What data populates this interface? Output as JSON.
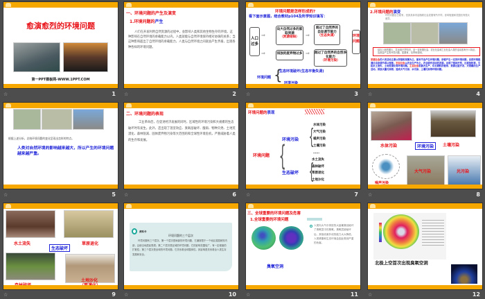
{
  "slides": [
    {
      "number": "1",
      "title": "愈演愈烈的环境问题",
      "footer": "第一PPT模板网-WWW.1PPT.COM"
    },
    {
      "number": "2",
      "heading": "一、环境问题的产生及演变",
      "sub_prefix": "1.环境问题的",
      "sub_highlight": "产生",
      "paragraph": "人们在开发利用自然资源的过程中，会影响人类和其他生物生存的环境。这种影响在自然环境的承载能力以内，人类就能与自然环境保持相对协调的关系；当这种影响超出了自然环境的承载能力，人类与自然环境之间就会产生矛盾，出现各种各样的环境问题。"
    },
    {
      "number": "3",
      "title": "环境问题是怎样形成的?",
      "instruction": "看下面示意图，结合教材p104及所学知识填写：",
      "cause": "人口过多",
      "box1": "向大自然过多的索取资源",
      "box1_answer": "（资源短缺）",
      "box2": "超过了自然界的自动调节能力",
      "box2_answer": "（生态失调）",
      "box3": "排放的废弃物过多",
      "box4": "超过了自然界的自然净化能力",
      "box4_answer": "（环境污染）",
      "result": "环境问题",
      "tree_root": "环境问题",
      "tree_a": "生态环境破坏(生态平衡失调)",
      "tree_b": "环境污染"
    },
    {
      "number": "4",
      "heading_prefix": "2.环境问题的",
      "heading_highlight": "演变",
      "intro": "环境问题自古就有，但其具体内容随着社会发展有所不同，影响程度和范围也有很大差异。",
      "boxtext": "结合上面的图片，并运用已学知识，谈一谈采猎社会、农业社会和工业社会人类的活动各有什么特点，及其会产生的环境问题，如果有，请举例说明。",
      "para_a": "采猎社会",
      "para_a_text": "的人类活动主要以狩猎和采集为主，基本不会产生环境问题，即使产生一定的环境问题，自然环境能通过自身调节得以恢复。",
      "para_b": "农业社会",
      "para_b_text": "以农业生产为主，农业耕作活动的发展，出现了毁林开荒、过度放牧等，引起水土流失、土地荒漠化等环境问题。",
      "para_c": "工业社会",
      "para_c_text": "机器大生产、化石燃料的使用、资源过度开发，大规模的生产活动，排放大量污染物，造成大气污染、水污染、土壤污染等环境问题。"
    },
    {
      "number": "5",
      "bullet": "根据上述分析，总结环境问题的变化呈现出怎样的特点。",
      "conclusion": "人类对自然环境的影响越来越大，所以产生的环境问题越来越严重。"
    },
    {
      "number": "6",
      "heading": "二、环境问题的表现",
      "paragraph": "工业革命后，在促进经济发展的同时，区域性的环境污染和大规模的生态破坏时有发生。此外，还出现了温室效应、臭氧层破坏、酸雨、物种灭绝、土地荒漠化、森林锐减、固体废弃物污染等大范围的和全球性环境危机，严重威胁着人类的生存和发展。"
    },
    {
      "number": "7",
      "heading_prefix": "环境问题的",
      "heading_highlight": "表现",
      "root": "环境问题",
      "branch_a": "环境污染",
      "branch_a_items": [
        "水体污染",
        "大气污染",
        "噪声污染",
        "土壤污染",
        "……"
      ],
      "branch_b": "生态破坏",
      "branch_b_items": [
        "水土流失",
        "森林破坏",
        "草原退化",
        "土地沙化",
        "……"
      ]
    },
    {
      "number": "8",
      "center": "环境污染",
      "labels": [
        "水体污染",
        "土壤污染",
        "噪声污染",
        "大气污染",
        "光污染"
      ]
    },
    {
      "number": "9",
      "center": "生态破坏",
      "labels": [
        "水土流失",
        "草原退化",
        "森林破坏",
        "土地沙化",
        "（荒漠化）"
      ]
    },
    {
      "number": "10",
      "card_label": "资料卡",
      "card_title": "环境问题的三个层次",
      "card_text": "环境问题有三个层次。第一个层次是局部的环境问题，它通常限于一个地区或国家的内部，且使当地居民受损；第二个层次是区域的环境问题，它的影响范围较广，有一定程度的扩散性；第三个层次是全球的环境问题，它关系着全球整体性，其影响是关系着全人类生存发展和安全。"
    },
    {
      "number": "11",
      "heading": "三、全球重要的环境问题及危害",
      "sub": "1.全球重要的环境问题",
      "caption": "臭氧空洞",
      "text": "人类向大气中排放的大量氟氯烃破坏了臭氧层中的臭氧。臭氧层被破坏后，其吸收紫外线的能力大大降低，人类健康和生态环境会因此受到严重的危害。"
    },
    {
      "number": "12",
      "headline": "北极上空首次出现臭氧空洞"
    }
  ],
  "colors": {
    "band": "#f7a800",
    "red": "#e8141a",
    "blue": "#1d22d8",
    "background": "#4d4d4d"
  }
}
